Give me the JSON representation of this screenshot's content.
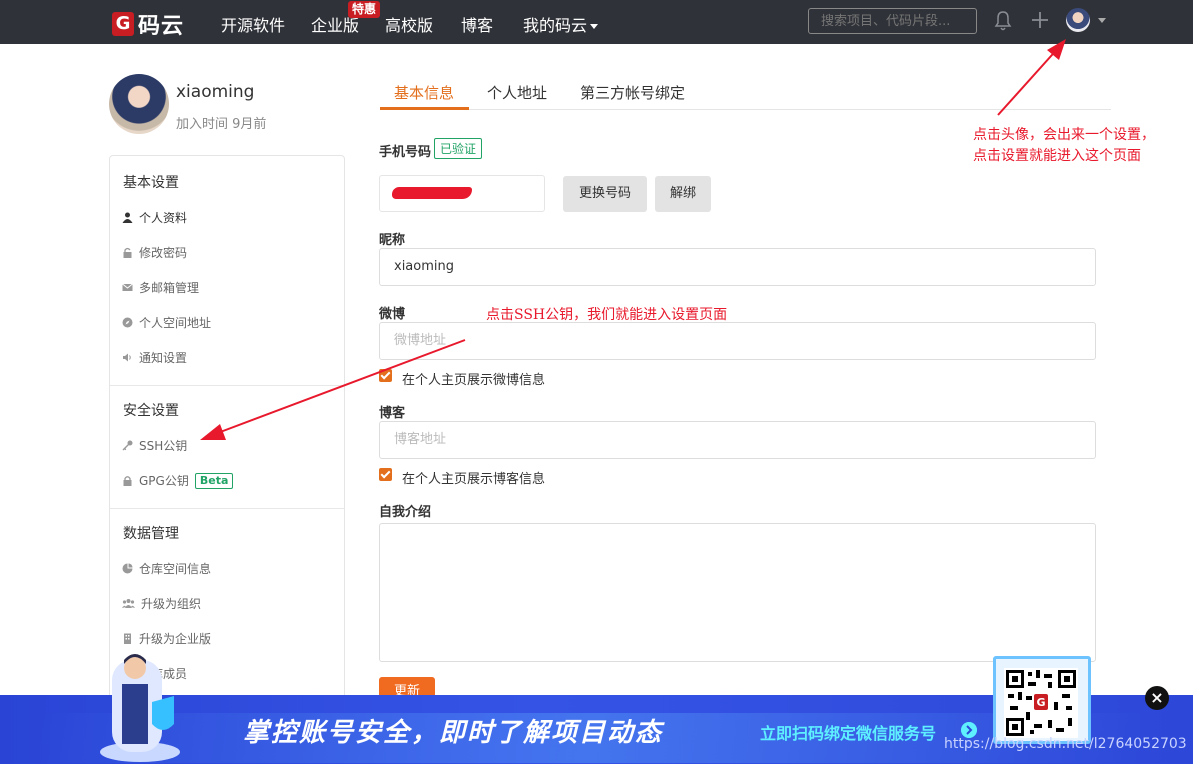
{
  "nav": {
    "logo_text": "码云",
    "items": [
      "开源软件",
      "企业版",
      "高校版",
      "博客",
      "我的码云"
    ],
    "hot_badge": "特惠",
    "search_placeholder": "搜索项目、代码片段..."
  },
  "profile": {
    "username": "xiaoming",
    "join_time": "加入时间 9月前"
  },
  "sidebar": {
    "basic_title": "基本设置",
    "basic_items": [
      "个人资料",
      "修改密码",
      "多邮箱管理",
      "个人空间地址",
      "通知设置"
    ],
    "security_title": "安全设置",
    "security_items": [
      "SSH公钥",
      "GPG公钥"
    ],
    "beta_badge": "Beta",
    "data_title": "数据管理",
    "data_items": [
      "仓库空间信息",
      "升级为组织",
      "升级为企业版",
      "仓库成员"
    ]
  },
  "tabs": [
    "基本信息",
    "个人地址",
    "第三方帐号绑定"
  ],
  "form": {
    "phone_label": "手机号码",
    "verified_badge": "已验证",
    "change_phone_label": "更换号码",
    "unbind_label": "解绑",
    "nickname_label": "昵称",
    "nickname_value": "xiaoming",
    "weibo_label": "微博",
    "weibo_placeholder": "微博地址",
    "weibo_show_label": "在个人主页展示微博信息",
    "blog_label": "博客",
    "blog_placeholder": "博客地址",
    "blog_show_label": "在个人主页展示博客信息",
    "intro_label": "自我介绍",
    "update_label": "更新"
  },
  "annotations": {
    "avatar_note_line1": "点击头像，会出来一个设置，",
    "avatar_note_line2": "点击设置就能进入这个页面",
    "ssh_note": "点击SSH公钥，我们就能进入设置页面"
  },
  "banner": {
    "title": "掌控账号安全，即时了解项目动态",
    "link": "立即扫码绑定微信服务号",
    "watermark": "https://blog.csdn.net/l2764052703"
  },
  "colors": {
    "accent": "#e36f1d",
    "nav_bg": "#2f3238",
    "brand_red": "#c71d23",
    "success": "#21a366",
    "annotation_red": "#e8192c",
    "banner_blue": "#3554e6"
  }
}
